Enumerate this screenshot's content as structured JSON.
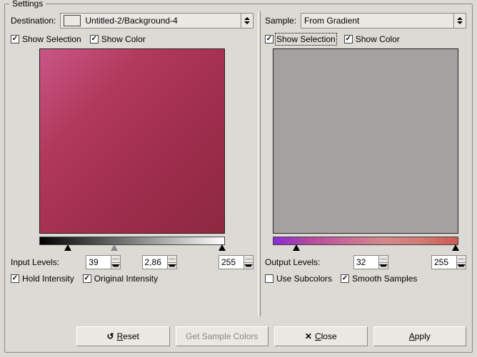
{
  "frame_title": "Settings",
  "dest": {
    "label": "Destination:",
    "selection": "Untitled-2/Background-4",
    "thumb_gradient": "linear-gradient(to right,#8b2dd0,#b74276,#c24a5f)",
    "show_selection": "Show Selection",
    "show_color": "Show Color",
    "input_levels_label": "Input Levels:",
    "level_low": "39",
    "level_mid": "2,86",
    "level_high": "255",
    "hold_intensity": "Hold Intensity",
    "original_intensity": "Original Intensity"
  },
  "sample": {
    "label": "Sample:",
    "selection": "From Gradient",
    "show_selection": "Show Selection",
    "show_color": "Show Color",
    "output_levels_label": "Output Levels:",
    "level_low": "32",
    "level_high": "255",
    "use_subcolors": "Use Subcolors",
    "smooth_samples": "Smooth Samples"
  },
  "buttons": {
    "reset": "Reset",
    "get_sample_colors": "Get Sample Colors",
    "close": "Close",
    "apply": "Apply"
  }
}
